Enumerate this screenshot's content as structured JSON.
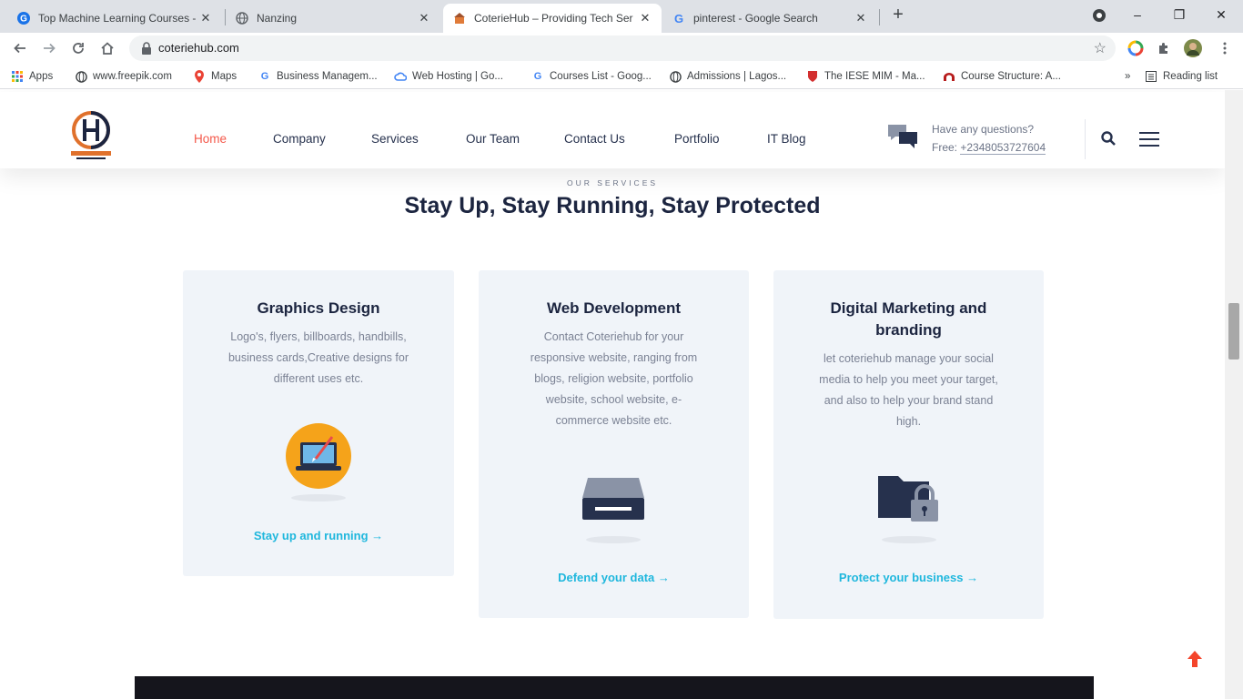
{
  "browser": {
    "tabs": [
      {
        "title": "Top Machine Learning Courses -",
        "icon": "google-g-icon"
      },
      {
        "title": "Nanzing",
        "icon": "globe-icon"
      },
      {
        "title": "CoterieHub – Providing Tech Ser",
        "icon": "site-favicon"
      },
      {
        "title": "pinterest - Google Search",
        "icon": "google-g-icon"
      }
    ],
    "new_tab": "+",
    "window_controls": {
      "minimize": "–",
      "restore": "❐",
      "close": "✕"
    },
    "url": "coteriehub.com",
    "bookmarks": [
      {
        "label": "Apps",
        "icon": "apps-grid-icon"
      },
      {
        "label": "www.freepik.com",
        "icon": "globe-icon"
      },
      {
        "label": "Maps",
        "icon": "maps-pin-icon"
      },
      {
        "label": "Business Managem...",
        "icon": "google-g-icon"
      },
      {
        "label": "Web Hosting | Go...",
        "icon": "cloud-icon"
      },
      {
        "label": "Courses List - Goog...",
        "icon": "google-g-icon"
      },
      {
        "label": "Admissions | Lagos...",
        "icon": "globe-icon"
      },
      {
        "label": "The IESE MIM - Ma...",
        "icon": "shield-icon"
      },
      {
        "label": "Course Structure: A...",
        "icon": "arch-icon"
      }
    ],
    "more_bookmarks": "»",
    "reading_list": "Reading list"
  },
  "site": {
    "nav": [
      "Home",
      "Company",
      "Services",
      "Our Team",
      "Contact Us",
      "Portfolio",
      "IT Blog"
    ],
    "contact_question": "Have any questions?",
    "contact_prefix": "Free:",
    "contact_phone": "+2348053727604"
  },
  "services": {
    "eyebrow": "OUR SERVICES",
    "title": "Stay Up, Stay Running, Stay Protected",
    "cards": [
      {
        "title": "Graphics Design",
        "lines": [
          "Logo's, flyers, billboards, handbills,",
          "business cards,Creative designs for",
          "different uses etc."
        ],
        "cta": "Stay up and running →",
        "icon": "laptop-brush-icon"
      },
      {
        "title": "Web Development",
        "lines": [
          "Contact Coteriehub for your",
          "responsive website, ranging from",
          "blogs, religion website, portfolio",
          "website, school website, e-",
          "commerce website etc."
        ],
        "cta": "Defend your data →",
        "icon": "server-drive-icon"
      },
      {
        "title_lines": [
          "Digital Marketing and",
          "branding"
        ],
        "lines": [
          "let coteriehub manage your social",
          "media to help you meet your target,",
          "and also to help your brand stand",
          "high."
        ],
        "cta": "Protect your business →",
        "icon": "folder-lock-icon"
      }
    ]
  },
  "colors": {
    "accent": "#f4584a",
    "link": "#1fb7dd",
    "heading": "#1c2540",
    "card_bg": "#f0f4f9"
  }
}
